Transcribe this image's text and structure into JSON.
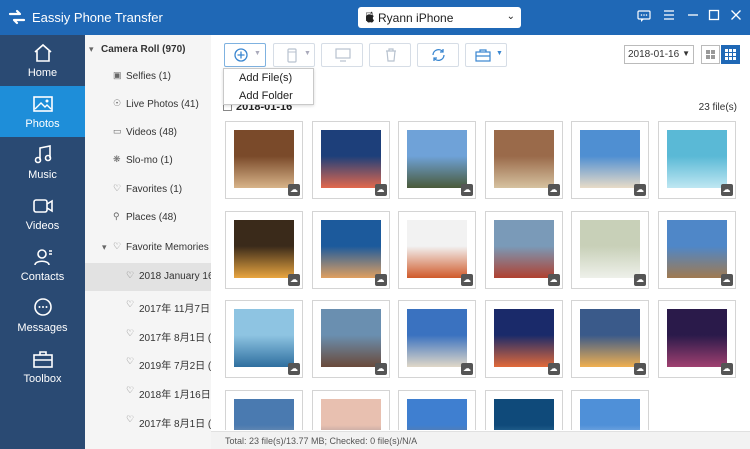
{
  "app": {
    "title": "Eassiy Phone Transfer",
    "device": "Ryann iPhone"
  },
  "nav": [
    {
      "label": "Home",
      "icon": "home-icon"
    },
    {
      "label": "Photos",
      "icon": "photos-icon",
      "active": true
    },
    {
      "label": "Music",
      "icon": "music-icon"
    },
    {
      "label": "Videos",
      "icon": "videos-icon"
    },
    {
      "label": "Contacts",
      "icon": "contacts-icon"
    },
    {
      "label": "Messages",
      "icon": "messages-icon"
    },
    {
      "label": "Toolbox",
      "icon": "toolbox-icon"
    }
  ],
  "tree": {
    "root": "Camera Roll (970)",
    "items": [
      {
        "label": "Selfies (1)",
        "icon": "selfie-icon"
      },
      {
        "label": "Live Photos (41)",
        "icon": "live-photo-icon"
      },
      {
        "label": "Videos (48)",
        "icon": "video-icon"
      },
      {
        "label": "Slo-mo (1)",
        "icon": "slomo-icon"
      },
      {
        "label": "Favorites (1)",
        "icon": "heart-icon"
      },
      {
        "label": "Places (48)",
        "icon": "pin-icon"
      },
      {
        "label": "Favorite Memories (36",
        "icon": "heart-icon"
      },
      {
        "label": "2018 January 16 (",
        "icon": "heart-icon"
      },
      {
        "label": "2017年 11月7日 (",
        "icon": "heart-icon"
      },
      {
        "label": "2017年 8月1日 (1",
        "icon": "heart-icon"
      },
      {
        "label": "2019年 7月2日 (8",
        "icon": "heart-icon"
      },
      {
        "label": "2018年 1月16日 (",
        "icon": "heart-icon"
      },
      {
        "label": "2017年 8月1日 (1",
        "icon": "heart-icon"
      }
    ]
  },
  "toolbar": {
    "menu": [
      "Add File(s)",
      "Add Folder"
    ],
    "date": "2018-01-16"
  },
  "content": {
    "date_header": "2018-01-16",
    "file_count": "23 file(s)",
    "photos": [
      "food table",
      "lake mountains",
      "castle",
      "city rooftops",
      "palace",
      "ocean waves",
      "sunset lake",
      "coastal village",
      "dessert plate",
      "golden gate bridge",
      "flowers",
      "plaza building",
      "boat sea",
      "mountain train",
      "leaning tower",
      "sunset sky",
      "sunrise clouds",
      "city night",
      "building",
      "city skyline",
      "cathedral",
      "waves",
      "sky"
    ]
  },
  "status": "Total: 23 file(s)/13.77 MB; Checked: 0 file(s)/N/A",
  "colors": {
    "titlebar": "#1f68b6",
    "nav": "#2a4a73",
    "nav_active": "#1e8ed9"
  }
}
